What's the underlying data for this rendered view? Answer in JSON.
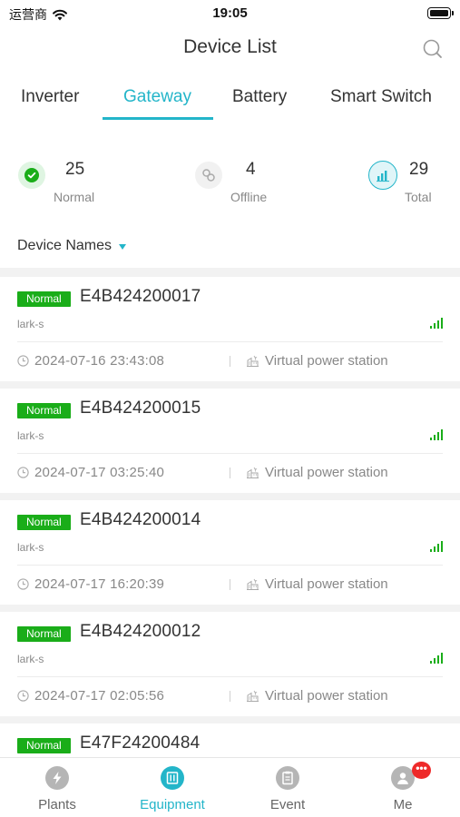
{
  "status_bar": {
    "carrier": "运营商",
    "time": "19:05"
  },
  "header": {
    "title": "Device List"
  },
  "tabs": [
    {
      "label": "Inverter",
      "active": false
    },
    {
      "label": "Gateway",
      "active": true
    },
    {
      "label": "Battery",
      "active": false
    },
    {
      "label": "Smart Switch",
      "active": false
    }
  ],
  "stats": {
    "normal": {
      "count": "25",
      "label": "Normal"
    },
    "offline": {
      "count": "4",
      "label": "Offline"
    },
    "total": {
      "count": "29",
      "label": "Total"
    }
  },
  "filter": {
    "label": "Device Names"
  },
  "devices": [
    {
      "status": "Normal",
      "id": "E4B424200017",
      "model": "lark-s",
      "time": "2024-07-16 23:43:08",
      "station": "Virtual power station"
    },
    {
      "status": "Normal",
      "id": "E4B424200015",
      "model": "lark-s",
      "time": "2024-07-17 03:25:40",
      "station": "Virtual power station"
    },
    {
      "status": "Normal",
      "id": "E4B424200014",
      "model": "lark-s",
      "time": "2024-07-17 16:20:39",
      "station": "Virtual power station"
    },
    {
      "status": "Normal",
      "id": "E4B424200012",
      "model": "lark-s",
      "time": "2024-07-17 02:05:56",
      "station": "Virtual power station"
    },
    {
      "status": "Normal",
      "id": "E47F24200484",
      "model": "",
      "time": "",
      "station": ""
    }
  ],
  "bottom_nav": [
    {
      "label": "Plants",
      "icon": "lightning-icon",
      "active": false
    },
    {
      "label": "Equipment",
      "icon": "equipment-icon",
      "active": true
    },
    {
      "label": "Event",
      "icon": "event-icon",
      "active": false
    },
    {
      "label": "Me",
      "icon": "user-icon",
      "active": false,
      "badge": "•••"
    }
  ],
  "colors": {
    "accent": "#23b5c9",
    "status_normal": "#1aad19",
    "badge_red": "#ee2a2a"
  }
}
